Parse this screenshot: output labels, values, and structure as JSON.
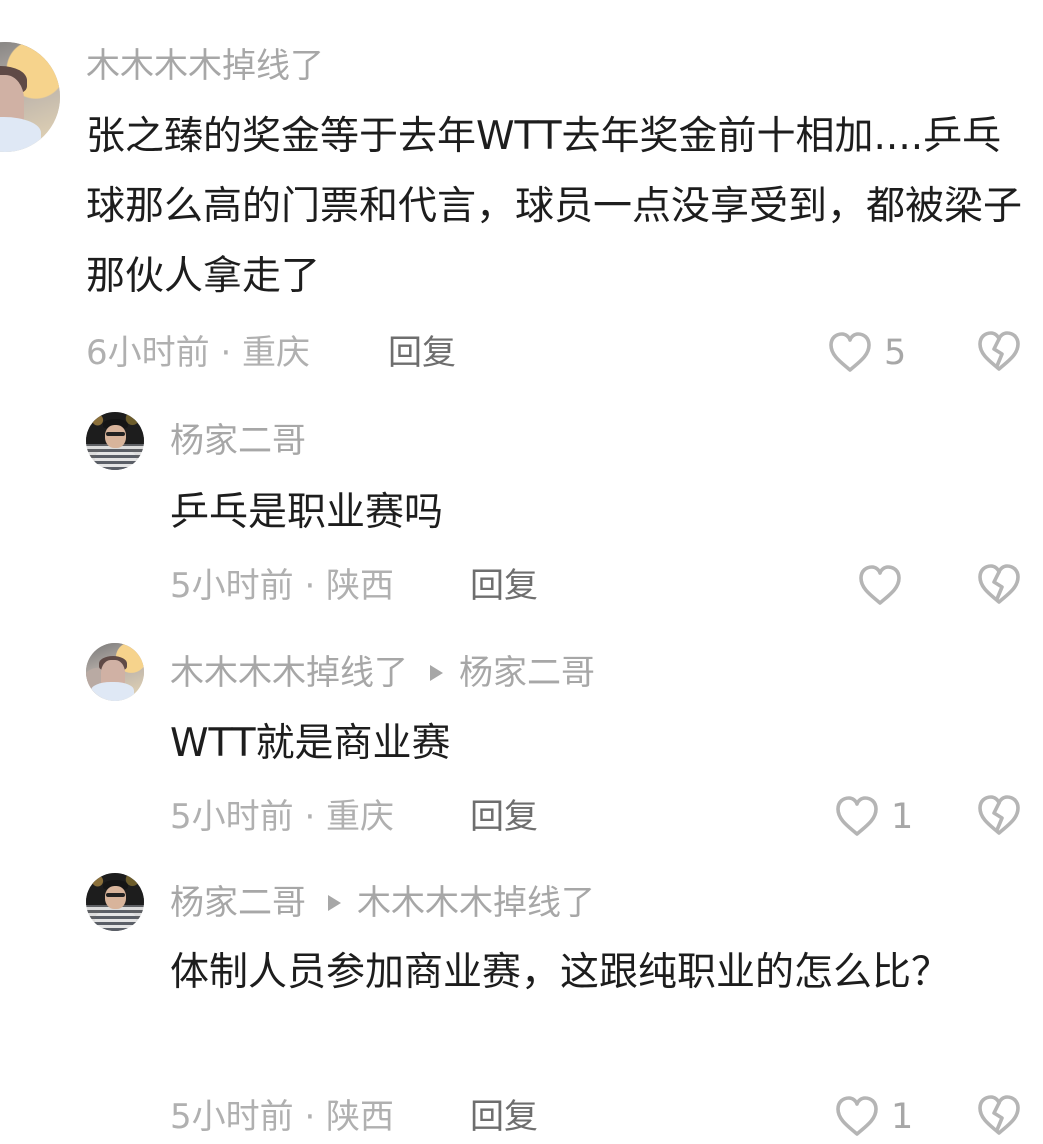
{
  "comments": [
    {
      "username": "木木木木掉线了",
      "content": "张之臻的奖金等于去年WTT去年奖金前十相加....乒乓球那么高的门票和代言，球员一点没享受到，都被梁子那伙人拿走了",
      "meta": "6小时前 · 重庆",
      "reply_label": "回复",
      "likes": "5"
    },
    {
      "username": "杨家二哥",
      "content": "乒乓是职业赛吗",
      "meta": "5小时前 · 陕西",
      "reply_label": "回复",
      "likes": ""
    },
    {
      "username": "木木木木掉线了",
      "reply_to": "杨家二哥",
      "content": "WTT就是商业赛",
      "meta": "5小时前 · 重庆",
      "reply_label": "回复",
      "likes": "1"
    },
    {
      "username": "杨家二哥",
      "reply_to": "木木木木掉线了",
      "content": "体制人员参加商业赛，这跟纯职业的怎么比？",
      "meta": "5小时前 · 陕西",
      "reply_label": "回复",
      "likes": "1"
    }
  ],
  "icons": {
    "like": "heart-outline-icon",
    "dislike": "broken-heart-icon",
    "reply_arrow": "right-triangle-icon"
  },
  "colors": {
    "username": "#a7a7a7",
    "content": "#1d1d1d",
    "meta": "#b0b0b0",
    "reply": "#6e6e6e",
    "icon": "#b5b5b5"
  }
}
